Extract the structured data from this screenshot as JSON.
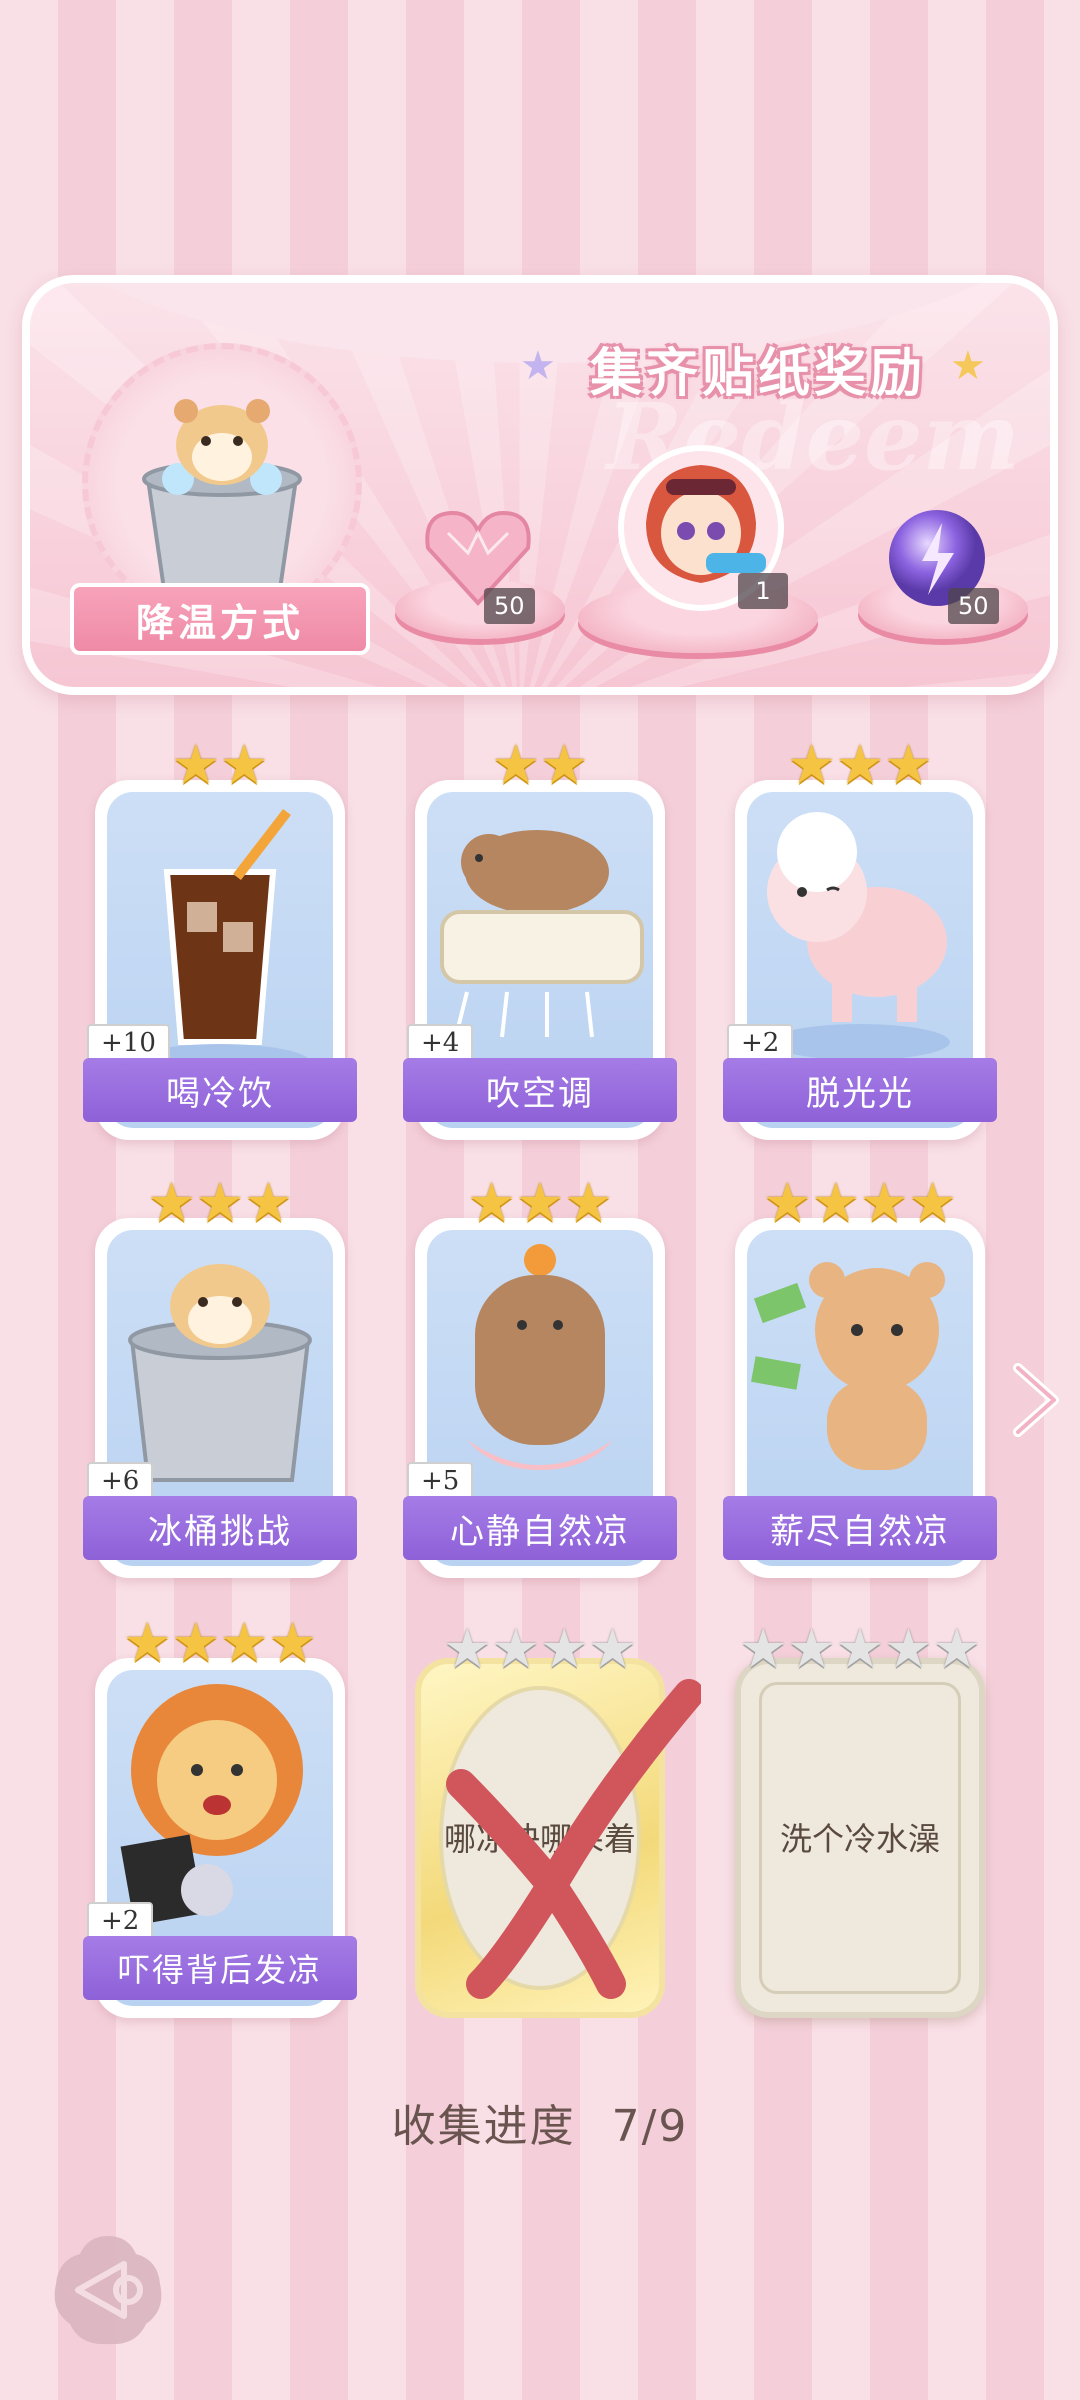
{
  "banner": {
    "title": "集齐贴纸奖励",
    "feature_label": "降温方式",
    "rewards": [
      {
        "name": "pink-heart-gem",
        "count": "50"
      },
      {
        "name": "character-avatar",
        "count": "1"
      },
      {
        "name": "purple-energy-orb",
        "count": "50"
      }
    ]
  },
  "cards": [
    {
      "name": "喝冷饮",
      "bonus": "+10",
      "stars": 2,
      "collected": true
    },
    {
      "name": "吹空调",
      "bonus": "+4",
      "stars": 2,
      "collected": true
    },
    {
      "name": "脱光光",
      "bonus": "+2",
      "stars": 3,
      "collected": true
    },
    {
      "name": "冰桶挑战",
      "bonus": "+6",
      "stars": 3,
      "collected": true
    },
    {
      "name": "心静自然凉",
      "bonus": "+5",
      "stars": 3,
      "collected": true
    },
    {
      "name": "薪尽自然凉",
      "bonus": "",
      "stars": 4,
      "collected": true
    },
    {
      "name": "吓得背后发凉",
      "bonus": "+2",
      "stars": 4,
      "collected": true
    },
    {
      "name": "哪凉快哪呆着",
      "bonus": "",
      "stars": 4,
      "collected": false
    },
    {
      "name": "洗个冷水澡",
      "bonus": "",
      "stars": 5,
      "collected": false
    }
  ],
  "progress": {
    "label": "收集进度",
    "value": "7/9"
  },
  "colors": {
    "accent_pink": "#ef8aa6",
    "card_purple": "#9a6fe0",
    "star_gold": "#f6c443"
  }
}
